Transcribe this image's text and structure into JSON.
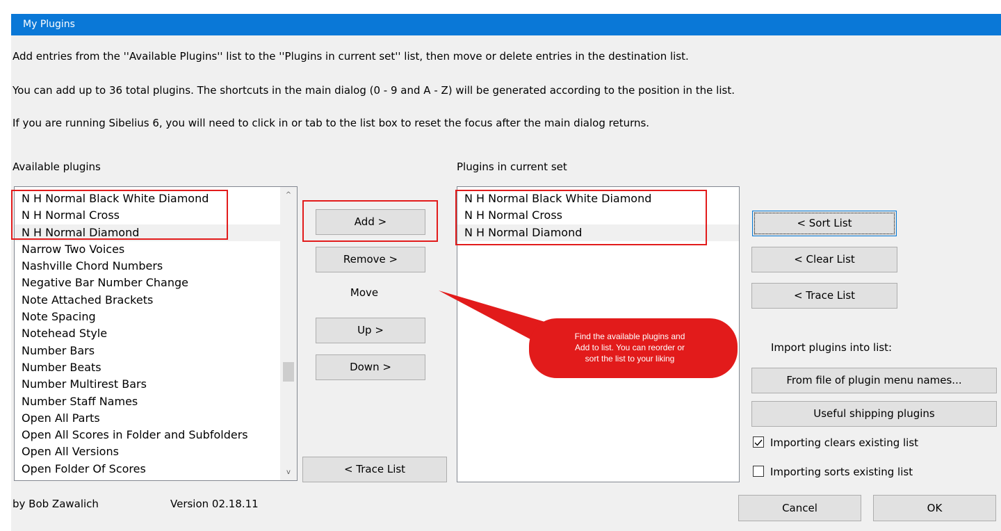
{
  "window": {
    "title": "My Plugins"
  },
  "instructions": [
    "Add entries from the ''Available Plugins'' list to the ''Plugins in current set'' list, then move or delete entries in the destination list.",
    "You can add up to 36 total plugins. The shortcuts in the main dialog (0 - 9 and A - Z) will be generated according to the position in the list.",
    "If you are running Sibelius 6, you will need to click in or tab to the list box to reset the focus after the main dialog returns."
  ],
  "available": {
    "label": "Available plugins",
    "items": [
      "N H Normal Black White Diamond",
      "N H Normal Cross",
      "N H Normal Diamond",
      "Narrow Two Voices",
      "Nashville Chord Numbers",
      "Negative Bar Number Change",
      "Note Attached Brackets",
      "Note Spacing",
      "Notehead Style",
      "Number Bars",
      "Number Beats",
      "Number Multirest Bars",
      "Number Staff Names",
      "Open All Parts",
      "Open All Scores in Folder and Subfolders",
      "Open All Versions",
      "Open Folder Of Scores"
    ],
    "selected_index": 2,
    "scroll_up": "^",
    "scroll_down": "v"
  },
  "middle": {
    "add": "Add >",
    "remove": "Remove >",
    "move_label": "Move",
    "up": "Up >",
    "down": "Down >",
    "trace": "< Trace List"
  },
  "current": {
    "label": "Plugins in current set",
    "items": [
      "N H Normal Black White Diamond",
      "N H Normal Cross",
      "N H Normal Diamond"
    ],
    "selected_index": 2
  },
  "right": {
    "sort": "< Sort List",
    "clear": "< Clear List",
    "trace": "< Trace List",
    "import_label": "Import plugins into list:",
    "from_file": "From file of plugin menu names...",
    "useful": "Useful shipping plugins",
    "import_clears": {
      "label": "Importing clears existing list",
      "checked": true
    },
    "import_sorts": {
      "label": "Importing sorts existing list",
      "checked": false
    }
  },
  "callout": {
    "lines": [
      "Find the available plugins and",
      "Add to list. You can reorder or",
      "sort the list to your liking"
    ],
    "color": "#e21b1b"
  },
  "footer": {
    "author": "by Bob Zawalich",
    "version": "Version 02.18.11",
    "cancel": "Cancel",
    "ok": "OK"
  },
  "colors": {
    "titlebar": "#0a78d7",
    "annotation": "#e21b1b",
    "dialog_bg": "#f0f0f0"
  }
}
